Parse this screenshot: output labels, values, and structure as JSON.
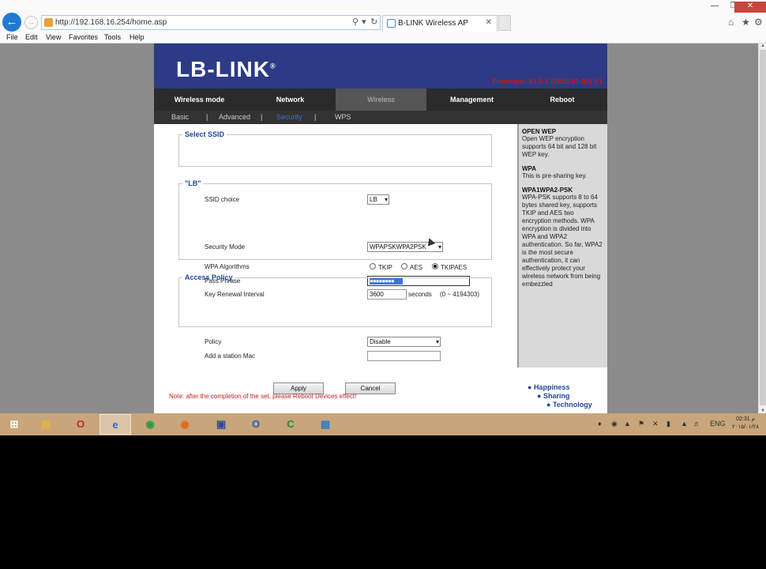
{
  "browser": {
    "url": "http://192.168.16.254/home.asp",
    "tab_title": "B-LINK Wireless AP",
    "menu": [
      "File",
      "Edit",
      "View",
      "Favorites",
      "Tools",
      "Help"
    ]
  },
  "router": {
    "logo": "LB-LINK",
    "logo_mark": "®",
    "firmware": "Firmware: V1.0.1 (2013-01-02) V1",
    "nav": [
      "Wireless mode",
      "Network",
      "Wireless",
      "Management",
      "Reboot"
    ],
    "nav_active": "Wireless",
    "subnav": [
      "Basic",
      "Advanced",
      "Security",
      "WPS"
    ],
    "subnav_active": "Security",
    "select_ssid": {
      "legend": "Select SSID",
      "label": "SSID choice",
      "value": "LB"
    },
    "security": {
      "legend": "\"LB\"",
      "mode_label": "Security Mode",
      "mode_value": "WPAPSKWPA2PSK",
      "algo_label": "WPA Algorithms",
      "algo_options": [
        "TKIP",
        "AES",
        "TKIPAES"
      ],
      "algo_selected": "TKIPAES",
      "pass_label": "Pass Phrase",
      "pass_value": "●●●●●●●●",
      "key_label": "Key Renewal Interval",
      "key_value": "3600",
      "key_unit": "seconds",
      "key_range": "(0 ~ 4194303)"
    },
    "access_policy": {
      "legend": "Access Policy",
      "policy_label": "Policy",
      "policy_value": "Disable",
      "mac_label": "Add a station Mac",
      "mac_value": ""
    },
    "buttons": {
      "apply": "Apply",
      "cancel": "Cancel"
    },
    "note": "Note: after the completion of the set, please Reboot Devices effect!",
    "slogans": [
      "Happiness",
      "Sharing",
      "Technology"
    ],
    "help": [
      {
        "title": "OPEN WEP",
        "text": "Open WEP encryption supports 64 bit and 128 bit WEP key."
      },
      {
        "title": "WPA",
        "text": "This is pre-sharing key."
      },
      {
        "title": "WPA1WPA2-PSK",
        "text": "WPA-PSK supports 8 to 64 bytes shared key, supports TKIP and AES two encryption methods. WPA encryption is divided into WPA and WPA2 authentication. So far, WPA2 is the most secure authentication, it can effectively protect your wireless network from being embezzled"
      }
    ]
  },
  "taskbar": {
    "apps": [
      "file-explorer",
      "opera",
      "internet-explorer",
      "chrome",
      "firefox",
      "network-app",
      "outlook",
      "camtasia",
      "remote-desktop"
    ],
    "lang": "ENG",
    "time": "02:31 م",
    "date": "۲۰۱۵/۰۱/۲۸"
  },
  "colors": {
    "banner": "#2d3a86",
    "accent": "#24479b",
    "taskbar": "#c8a57a",
    "note": "#c81c1c"
  }
}
